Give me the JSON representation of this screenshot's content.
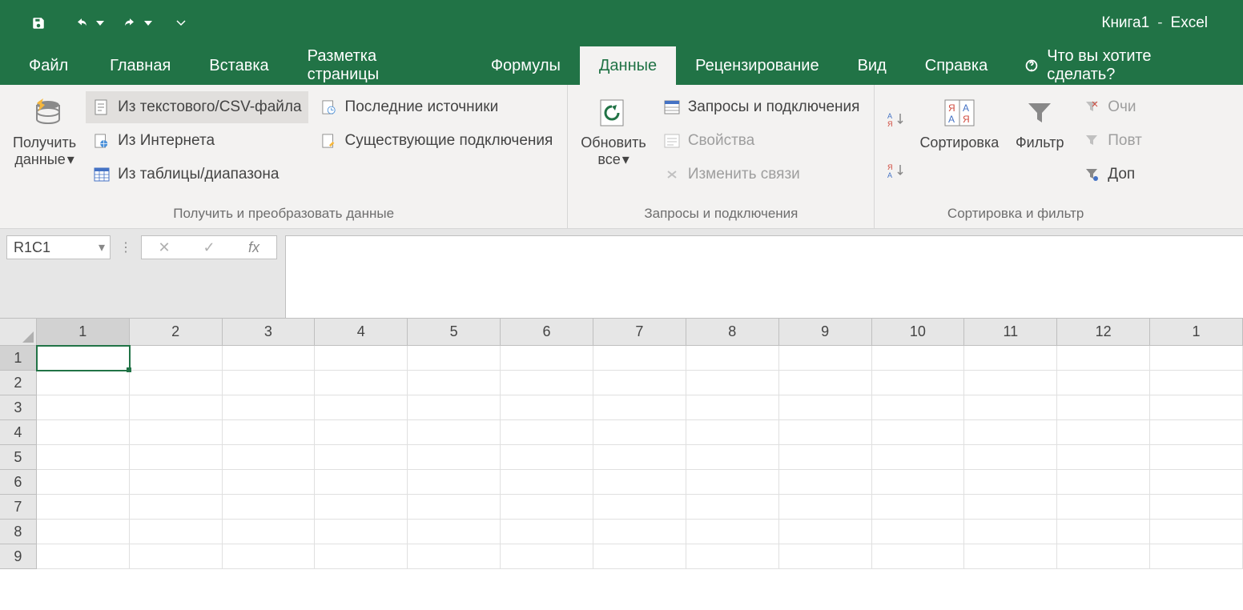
{
  "title": {
    "document": "Книга1",
    "separator": "-",
    "app": "Excel"
  },
  "tabs": {
    "file": "Файл",
    "home": "Главная",
    "insert": "Вставка",
    "pagelayout": "Разметка страницы",
    "formulas": "Формулы",
    "data": "Данные",
    "review": "Рецензирование",
    "view": "Вид",
    "help": "Справка",
    "tellme": "Что вы хотите сделать?"
  },
  "ribbon": {
    "group1": {
      "getdata": "Получить\nданные",
      "fromcsv": "Из текстового/CSV-файла",
      "frominternet": "Из Интернета",
      "fromtable": "Из таблицы/диапазона",
      "recentsources": "Последние источники",
      "existingconn": "Существующие подключения",
      "label": "Получить и преобразовать данные"
    },
    "group2": {
      "refreshall": "Обновить\nвсе",
      "queries": "Запросы и подключения",
      "properties": "Свойства",
      "editlinks": "Изменить связи",
      "label": "Запросы и подключения"
    },
    "group3": {
      "sort": "Сортировка",
      "filter": "Фильтр",
      "clear": "Очи",
      "reapply": "Повт",
      "advanced": "Доп",
      "label": "Сортировка и фильтр"
    }
  },
  "formulabar": {
    "namebox": "R1C1"
  },
  "grid": {
    "cols": [
      "1",
      "2",
      "3",
      "4",
      "5",
      "6",
      "7",
      "8",
      "9",
      "10",
      "11",
      "12",
      "1"
    ],
    "rows": [
      "1",
      "2",
      "3",
      "4",
      "5",
      "6",
      "7",
      "8",
      "9"
    ],
    "activeCol": 0,
    "activeRow": 0
  }
}
